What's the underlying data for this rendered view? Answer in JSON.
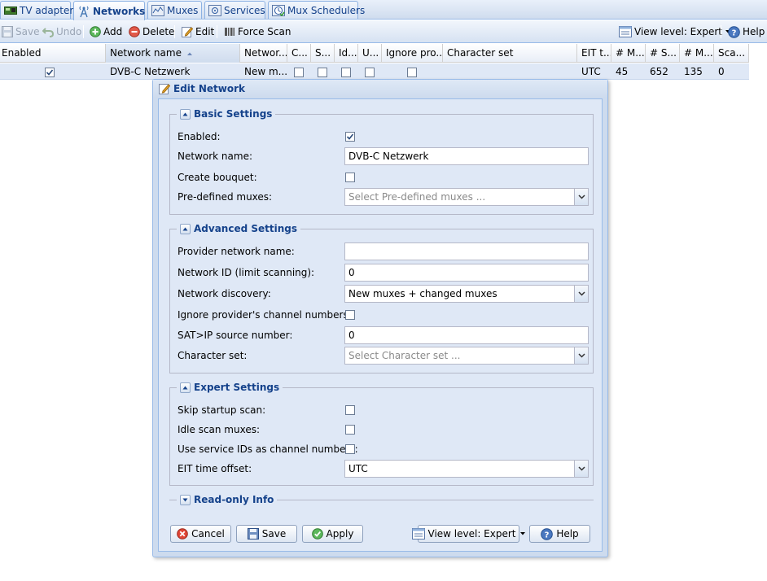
{
  "tabs": [
    {
      "label": "TV adapters",
      "icon": "tv-card-icon"
    },
    {
      "label": "Networks",
      "icon": "antenna-icon",
      "active": true
    },
    {
      "label": "Muxes",
      "icon": "mux-icon"
    },
    {
      "label": "Services",
      "icon": "services-icon"
    },
    {
      "label": "Mux Schedulers",
      "icon": "scheduler-icon"
    }
  ],
  "toolbar": {
    "save": "Save",
    "undo": "Undo",
    "add": "Add",
    "delete": "Delete",
    "edit": "Edit",
    "force_scan": "Force Scan",
    "view_level": "View level: Expert",
    "help": "Help"
  },
  "grid": {
    "columns": [
      "Enabled",
      "Network name",
      "Networ...",
      "C...",
      "S...",
      "Id...",
      "U...",
      "Ignore pro...",
      "Character set",
      "EIT t...",
      "# M...",
      "# S...",
      "# M...",
      "Sca..."
    ],
    "row": {
      "enabled": true,
      "network_name": "DVB-C Netzwerk",
      "discovery": "New m...",
      "eit_offset": "UTC",
      "num_muxes": "45",
      "num_services": "652",
      "num_mapped": "135",
      "scan_queue": "0"
    }
  },
  "dialog": {
    "title": "Edit Network",
    "basic": {
      "legend": "Basic Settings",
      "enabled_label": "Enabled:",
      "enabled": true,
      "name_label": "Network name:",
      "name_value": "DVB-C Netzwerk",
      "bouquet_label": "Create bouquet:",
      "bouquet": false,
      "muxes_label": "Pre-defined muxes:",
      "muxes_placeholder": "Select Pre-defined muxes ..."
    },
    "advanced": {
      "legend": "Advanced Settings",
      "provider_label": "Provider network name:",
      "provider_value": "",
      "netid_label": "Network ID (limit scanning):",
      "netid_value": "0",
      "discovery_label": "Network discovery:",
      "discovery_value": "New muxes + changed muxes",
      "ignore_label": "Ignore provider's channel numbers:",
      "ignore": false,
      "satip_label": "SAT>IP source number:",
      "satip_value": "0",
      "charset_label": "Character set:",
      "charset_placeholder": "Select Character set ..."
    },
    "expert": {
      "legend": "Expert Settings",
      "skip_label": "Skip startup scan:",
      "skip": false,
      "idle_label": "Idle scan muxes:",
      "idle": false,
      "sid_label": "Use service IDs as channel numbers:",
      "sid": false,
      "eit_label": "EIT time offset:",
      "eit_value": "UTC"
    },
    "readonly_legend": "Read-only Info",
    "buttons": {
      "cancel": "Cancel",
      "save": "Save",
      "apply": "Apply",
      "view_level": "View level: Expert",
      "help": "Help"
    }
  },
  "colors": {
    "accent": "#15428b",
    "panel": "#dfe8f6",
    "border": "#99bbe8",
    "row_selected": "#dfe8f6"
  }
}
